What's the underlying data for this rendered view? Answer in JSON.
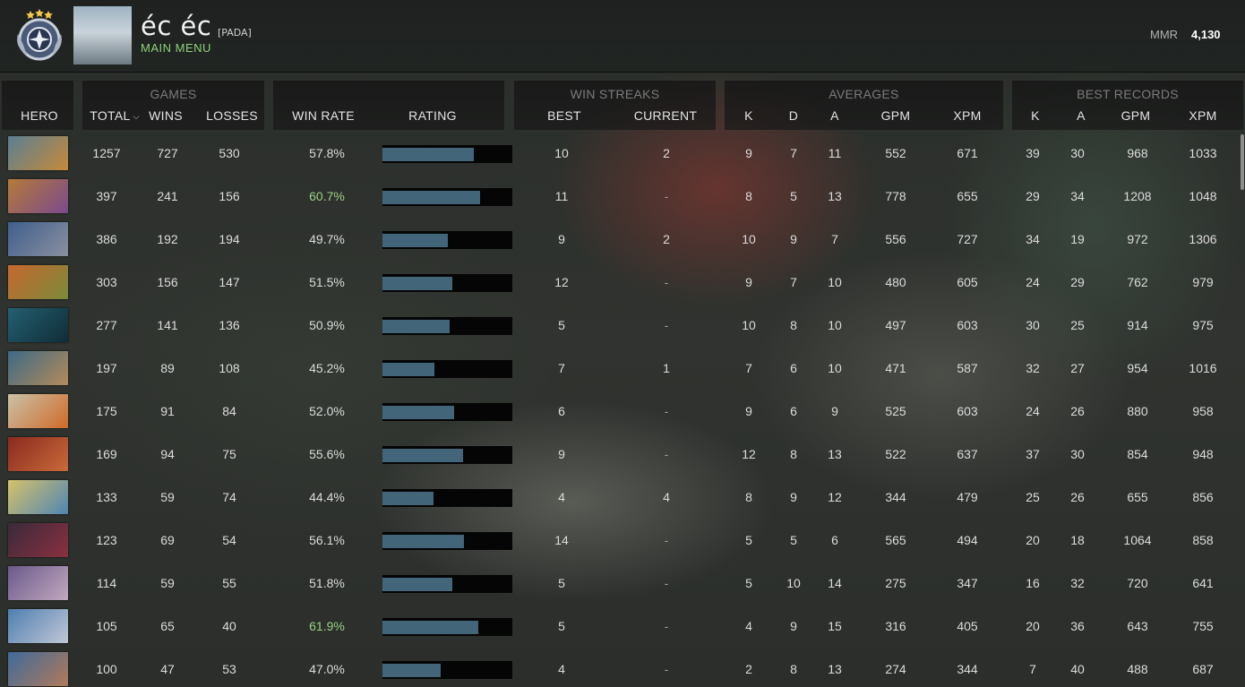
{
  "header": {
    "player_name": "éc éc",
    "player_tag": "[PADA]",
    "subtitle": "MAIN MENU",
    "mmr_label": "MMR",
    "mmr_value": "4,130"
  },
  "groups": {
    "games": "GAMES",
    "win_streaks": "WIN STREAKS",
    "averages": "AVERAGES",
    "best_records": "BEST RECORDS"
  },
  "columns": {
    "hero": "HERO",
    "total": "TOTAL",
    "wins": "WINS",
    "losses": "LOSSES",
    "win_rate": "WIN RATE",
    "rating": "RATING",
    "best": "BEST",
    "current": "CURRENT",
    "avg_k": "K",
    "avg_d": "D",
    "avg_a": "A",
    "avg_gpm": "GPM",
    "avg_xpm": "XPM",
    "best_k": "K",
    "best_a": "A",
    "best_gpm": "GPM",
    "best_xpm": "XPM"
  },
  "colors": {
    "accent_green": "#8fd17a",
    "high_winrate": "#9bd084",
    "rating_fill": "#43657a",
    "rating_track": "#050505"
  },
  "rows": [
    {
      "total": "1257",
      "wins": "727",
      "losses": "530",
      "win_rate": "57.8%",
      "high": false,
      "rating": 0.7,
      "best": "10",
      "current": "2",
      "k": "9",
      "d": "7",
      "a": "11",
      "gpm": "552",
      "xpm": "671",
      "bk": "39",
      "ba": "30",
      "bgpm": "968",
      "bxpm": "1033",
      "portrait": [
        "#5b7f93",
        "#c58a3a"
      ]
    },
    {
      "total": "397",
      "wins": "241",
      "losses": "156",
      "win_rate": "60.7%",
      "high": true,
      "rating": 0.75,
      "best": "11",
      "current": "-",
      "k": "8",
      "d": "5",
      "a": "13",
      "gpm": "778",
      "xpm": "655",
      "bk": "29",
      "ba": "34",
      "bgpm": "1208",
      "bxpm": "1048",
      "portrait": [
        "#b57a3a",
        "#7b4a8c"
      ]
    },
    {
      "total": "386",
      "wins": "192",
      "losses": "194",
      "win_rate": "49.7%",
      "high": false,
      "rating": 0.5,
      "best": "9",
      "current": "2",
      "k": "10",
      "d": "9",
      "a": "7",
      "gpm": "556",
      "xpm": "727",
      "bk": "34",
      "ba": "19",
      "bgpm": "972",
      "bxpm": "1306",
      "portrait": [
        "#3f5f8c",
        "#8a8fa0"
      ]
    },
    {
      "total": "303",
      "wins": "156",
      "losses": "147",
      "win_rate": "51.5%",
      "high": false,
      "rating": 0.54,
      "best": "12",
      "current": "-",
      "k": "9",
      "d": "7",
      "a": "10",
      "gpm": "480",
      "xpm": "605",
      "bk": "24",
      "ba": "29",
      "bgpm": "762",
      "bxpm": "979",
      "portrait": [
        "#c7682e",
        "#7a8a3a"
      ]
    },
    {
      "total": "277",
      "wins": "141",
      "losses": "136",
      "win_rate": "50.9%",
      "high": false,
      "rating": 0.52,
      "best": "5",
      "current": "-",
      "k": "10",
      "d": "8",
      "a": "10",
      "gpm": "497",
      "xpm": "603",
      "bk": "30",
      "ba": "25",
      "bgpm": "914",
      "bxpm": "975",
      "portrait": [
        "#245f70",
        "#0f2d38"
      ]
    },
    {
      "total": "197",
      "wins": "89",
      "losses": "108",
      "win_rate": "45.2%",
      "high": false,
      "rating": 0.4,
      "best": "7",
      "current": "1",
      "k": "7",
      "d": "6",
      "a": "10",
      "gpm": "471",
      "xpm": "587",
      "bk": "32",
      "ba": "27",
      "bgpm": "954",
      "bxpm": "1016",
      "portrait": [
        "#3d6a86",
        "#b48a5a"
      ]
    },
    {
      "total": "175",
      "wins": "91",
      "losses": "84",
      "win_rate": "52.0%",
      "high": false,
      "rating": 0.55,
      "best": "6",
      "current": "-",
      "k": "9",
      "d": "6",
      "a": "9",
      "gpm": "525",
      "xpm": "603",
      "bk": "24",
      "ba": "26",
      "bgpm": "880",
      "bxpm": "958",
      "portrait": [
        "#c9c2a6",
        "#d06a2a"
      ]
    },
    {
      "total": "169",
      "wins": "94",
      "losses": "75",
      "win_rate": "55.6%",
      "high": false,
      "rating": 0.62,
      "best": "9",
      "current": "-",
      "k": "12",
      "d": "8",
      "a": "13",
      "gpm": "522",
      "xpm": "637",
      "bk": "37",
      "ba": "30",
      "bgpm": "854",
      "bxpm": "948",
      "portrait": [
        "#8a2a1f",
        "#c96a3a"
      ]
    },
    {
      "total": "133",
      "wins": "59",
      "losses": "74",
      "win_rate": "44.4%",
      "high": false,
      "rating": 0.39,
      "best": "4",
      "current": "4",
      "k": "8",
      "d": "9",
      "a": "12",
      "gpm": "344",
      "xpm": "479",
      "bk": "25",
      "ba": "26",
      "bgpm": "655",
      "bxpm": "856",
      "portrait": [
        "#d6c26a",
        "#4f86b0"
      ]
    },
    {
      "total": "123",
      "wins": "69",
      "losses": "54",
      "win_rate": "56.1%",
      "high": false,
      "rating": 0.63,
      "best": "14",
      "current": "-",
      "k": "5",
      "d": "5",
      "a": "6",
      "gpm": "565",
      "xpm": "494",
      "bk": "20",
      "ba": "18",
      "bgpm": "1064",
      "bxpm": "858",
      "portrait": [
        "#3a2a3a",
        "#8a3040"
      ]
    },
    {
      "total": "114",
      "wins": "59",
      "losses": "55",
      "win_rate": "51.8%",
      "high": false,
      "rating": 0.54,
      "best": "5",
      "current": "-",
      "k": "5",
      "d": "10",
      "a": "14",
      "gpm": "275",
      "xpm": "347",
      "bk": "16",
      "ba": "32",
      "bgpm": "720",
      "bxpm": "641",
      "portrait": [
        "#6a5a8a",
        "#c2a8c0"
      ]
    },
    {
      "total": "105",
      "wins": "65",
      "losses": "40",
      "win_rate": "61.9%",
      "high": true,
      "rating": 0.74,
      "best": "5",
      "current": "-",
      "k": "4",
      "d": "9",
      "a": "15",
      "gpm": "316",
      "xpm": "405",
      "bk": "20",
      "ba": "36",
      "bgpm": "643",
      "bxpm": "755",
      "portrait": [
        "#4f7fb0",
        "#c0c6d6"
      ]
    },
    {
      "total": "100",
      "wins": "47",
      "losses": "53",
      "win_rate": "47.0%",
      "high": false,
      "rating": 0.45,
      "best": "4",
      "current": "-",
      "k": "2",
      "d": "8",
      "a": "13",
      "gpm": "274",
      "xpm": "344",
      "bk": "7",
      "ba": "40",
      "bgpm": "488",
      "bxpm": "687",
      "portrait": [
        "#3f6a9a",
        "#b07a5a"
      ]
    }
  ]
}
